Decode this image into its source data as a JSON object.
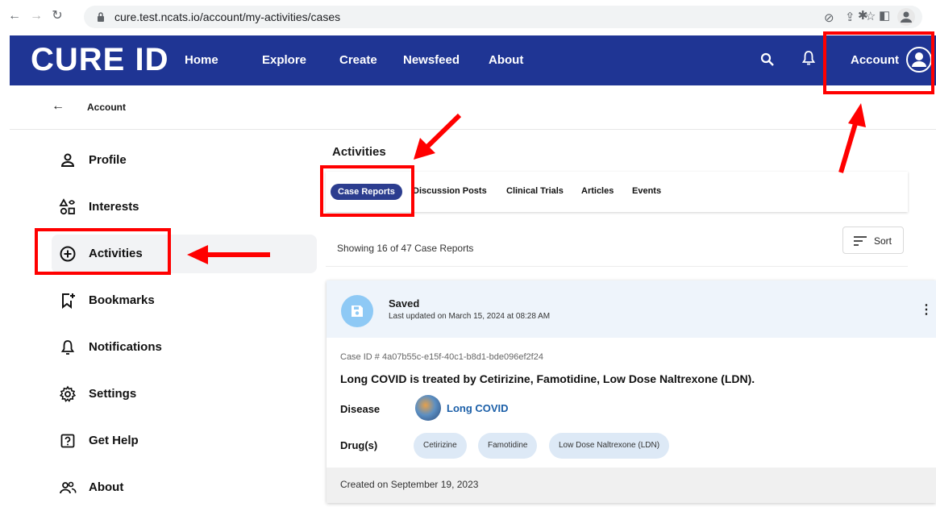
{
  "browser": {
    "url": "cure.test.ncats.io/account/my-activities/cases"
  },
  "header": {
    "logo": "CURE ID",
    "nav": [
      "Home",
      "Explore",
      "Create",
      "Newsfeed",
      "About"
    ],
    "account_label": "Account"
  },
  "subheader": {
    "title": "Account"
  },
  "sidebar": {
    "items": [
      {
        "label": "Profile",
        "icon": "person-icon"
      },
      {
        "label": "Interests",
        "icon": "interests-icon"
      },
      {
        "label": "Activities",
        "icon": "add-circle-icon",
        "active": true
      },
      {
        "label": "Bookmarks",
        "icon": "bookmark-add-icon"
      },
      {
        "label": "Notifications",
        "icon": "bell-icon"
      },
      {
        "label": "Settings",
        "icon": "gear-icon"
      },
      {
        "label": "Get Help",
        "icon": "help-icon"
      },
      {
        "label": "About",
        "icon": "people-icon"
      }
    ]
  },
  "main": {
    "title": "Activities",
    "tabs": [
      "Case Reports",
      "Discussion Posts",
      "Clinical Trials",
      "Articles",
      "Events"
    ],
    "active_tab": "Case Reports",
    "showing": "Showing 16 of 47 Case Reports",
    "sort_label": "Sort"
  },
  "card": {
    "status": "Saved",
    "updated": "Last updated on March 15, 2024 at 08:28 AM",
    "case_id": "Case ID # 4a07b55c-e15f-40c1-b8d1-bde096ef2f24",
    "title": "Long COVID is treated by Cetirizine, Famotidine, Low Dose Naltrexone (LDN).",
    "disease_label": "Disease",
    "disease": "Long COVID",
    "drugs_label": "Drug(s)",
    "drugs": [
      "Cetirizine",
      "Famotidine",
      "Low Dose Naltrexone (LDN)"
    ],
    "created": "Created on September 19, 2023"
  },
  "colors": {
    "header_bg": "#1f3594",
    "active_tab": "#2c3d8f",
    "link": "#1b5fa8",
    "annotation": "#ff0000"
  }
}
